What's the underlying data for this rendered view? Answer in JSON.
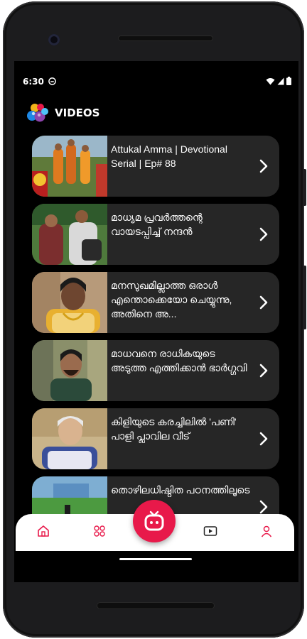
{
  "status_bar": {
    "time": "6:30",
    "icons": [
      "notification-icon",
      "wifi-icon",
      "cell-signal-icon",
      "battery-icon"
    ]
  },
  "header": {
    "title": "VIDEOS",
    "logo_icon": "app-logo-balls-icon"
  },
  "videos": [
    {
      "title": "Attukal Amma | Devotional Serial | Ep# 88"
    },
    {
      "title": "മാധ്യമ പ്രവർത്തന്റെ വായടപ്പിച്ച് നന്ദൻ"
    },
    {
      "title": "മനസുഖമില്ലാത്ത ഒരാൾ എന്തൊക്കെയോ ചെയ്യുന്നു, അതിനെ അ..."
    },
    {
      "title": "മാധവനെ രാധികയുടെ അടുത്ത എത്തിക്കാൻ ഭാർഗ്ഗവി"
    },
    {
      "title": "കിളിയുടെ കരച്ചിലിൽ 'പണി' പാളി പ്ലാവില വീട്"
    },
    {
      "title": "തൊഴിലധിഷ്ഠിത പഠനത്തിലൂടെ"
    }
  ],
  "bottom_nav": {
    "items": [
      "home-icon",
      "grid-icon",
      "tv-icon",
      "video-play-icon",
      "profile-icon"
    ],
    "accent_color": "#e8194a"
  },
  "colors": {
    "background": "#000000",
    "card": "#262626",
    "accent": "#e8194a"
  }
}
